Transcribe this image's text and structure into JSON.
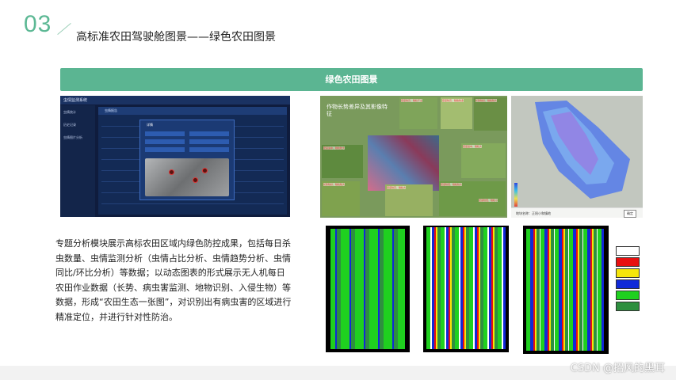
{
  "header": {
    "section_number": "03",
    "title": "高标准农田驾驶舱图景——绿色农田图景"
  },
  "banner": {
    "label": "绿色农田图景"
  },
  "dashboard": {
    "app_title": "虫情监测系统",
    "sidebar_items": [
      "虫情统计",
      "历史记录",
      "虫情图片分析"
    ],
    "table_header": "虫情报告",
    "popup_title": "详情"
  },
  "collage": {
    "title": "作物长势差异及其影像特征",
    "labels": [
      "密度较高、穗粒不全",
      "密度较高、穗数较多",
      "长势较好、穗粒较大",
      "密度适中、穗粒较大",
      "密度适中、穗粒大",
      "长势较好、穗粒较大",
      "密度较高、穗粒大",
      "密度较低、穗粒较大",
      "密度较低、穗粒小"
    ]
  },
  "heatmap": {
    "footer_text": "地块名称：正阳小和镇地",
    "footer_button": "确定"
  },
  "description": "专题分析模块展示高标农田区域内绿色防控成果，包括每日杀虫数量、虫情监测分析（虫情占比分析、虫情趋势分析、虫情同比/环比分析）等数据；以动态图表的形式展示无人机每日农田作业数据（长势、病虫害监测、地物识别、入侵生物）等数据，形成“农田生态一张图”，对识别出有病虫害的区域进行精准定位，并进行针对性防治。",
  "map_key_colors": [
    "#ffffff",
    "#e81010",
    "#f5e50a",
    "#1029d8",
    "#1fd01f",
    "#2e8f3f"
  ],
  "watermark": "CSDN @招风的黑耳"
}
